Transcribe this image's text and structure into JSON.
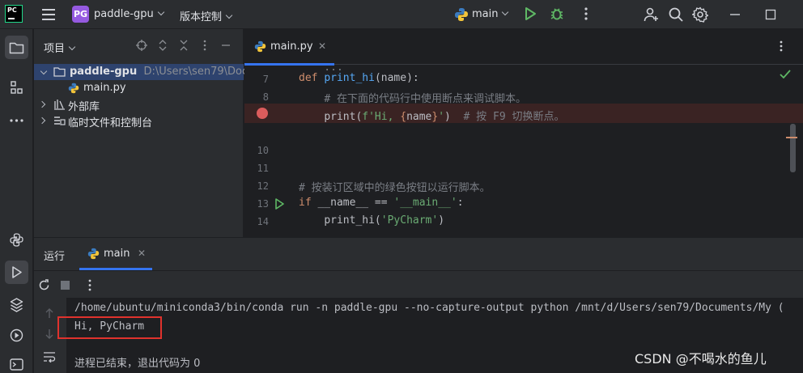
{
  "titlebar": {
    "app_logo": "PC",
    "project_badge": "PG",
    "project_name": "paddle-gpu",
    "vcs_label": "版本控制",
    "run_config": "main"
  },
  "project_panel": {
    "title": "项目",
    "tree": [
      {
        "label": "paddle-gpu",
        "path": "D:\\Users\\sen79\\Docu",
        "icon": "folder-icon",
        "expanded": true
      },
      {
        "label": "main.py",
        "icon": "python-file-icon"
      },
      {
        "label": "外部库",
        "icon": "library-icon",
        "expanded": false
      },
      {
        "label": "临时文件和控制台",
        "icon": "scratch-icon",
        "expanded": false
      }
    ]
  },
  "editor": {
    "tab_label": "main.py",
    "lines": [
      {
        "num": "7"
      },
      {
        "num": "8",
        "comment": "# 在下面的代码行中使用断点来调试脚本。"
      },
      {
        "num": "",
        "comment": "# 按 F9 切换断点。"
      },
      {
        "num": "10"
      },
      {
        "num": "11"
      },
      {
        "num": "12",
        "comment": "# 按装订区域中的绿色按钮以运行脚本。"
      },
      {
        "num": "13"
      },
      {
        "num": "14"
      }
    ]
  },
  "run_panel": {
    "title": "运行",
    "tab_label": "main",
    "console": [
      "/home/ubuntu/miniconda3/bin/conda run -n paddle-gpu --no-capture-output python /mnt/d/Users/sen79/Documents/My (",
      "Hi, PyCharm",
      "",
      "进程已结束，退出代码为 0"
    ]
  },
  "watermark": "CSDN @不喝水的鱼儿",
  "colors": {
    "accent": "#3574f0",
    "breakpoint": "#db5c5c",
    "highlight_box": "#e0322d",
    "run_green": "#5fb865"
  }
}
